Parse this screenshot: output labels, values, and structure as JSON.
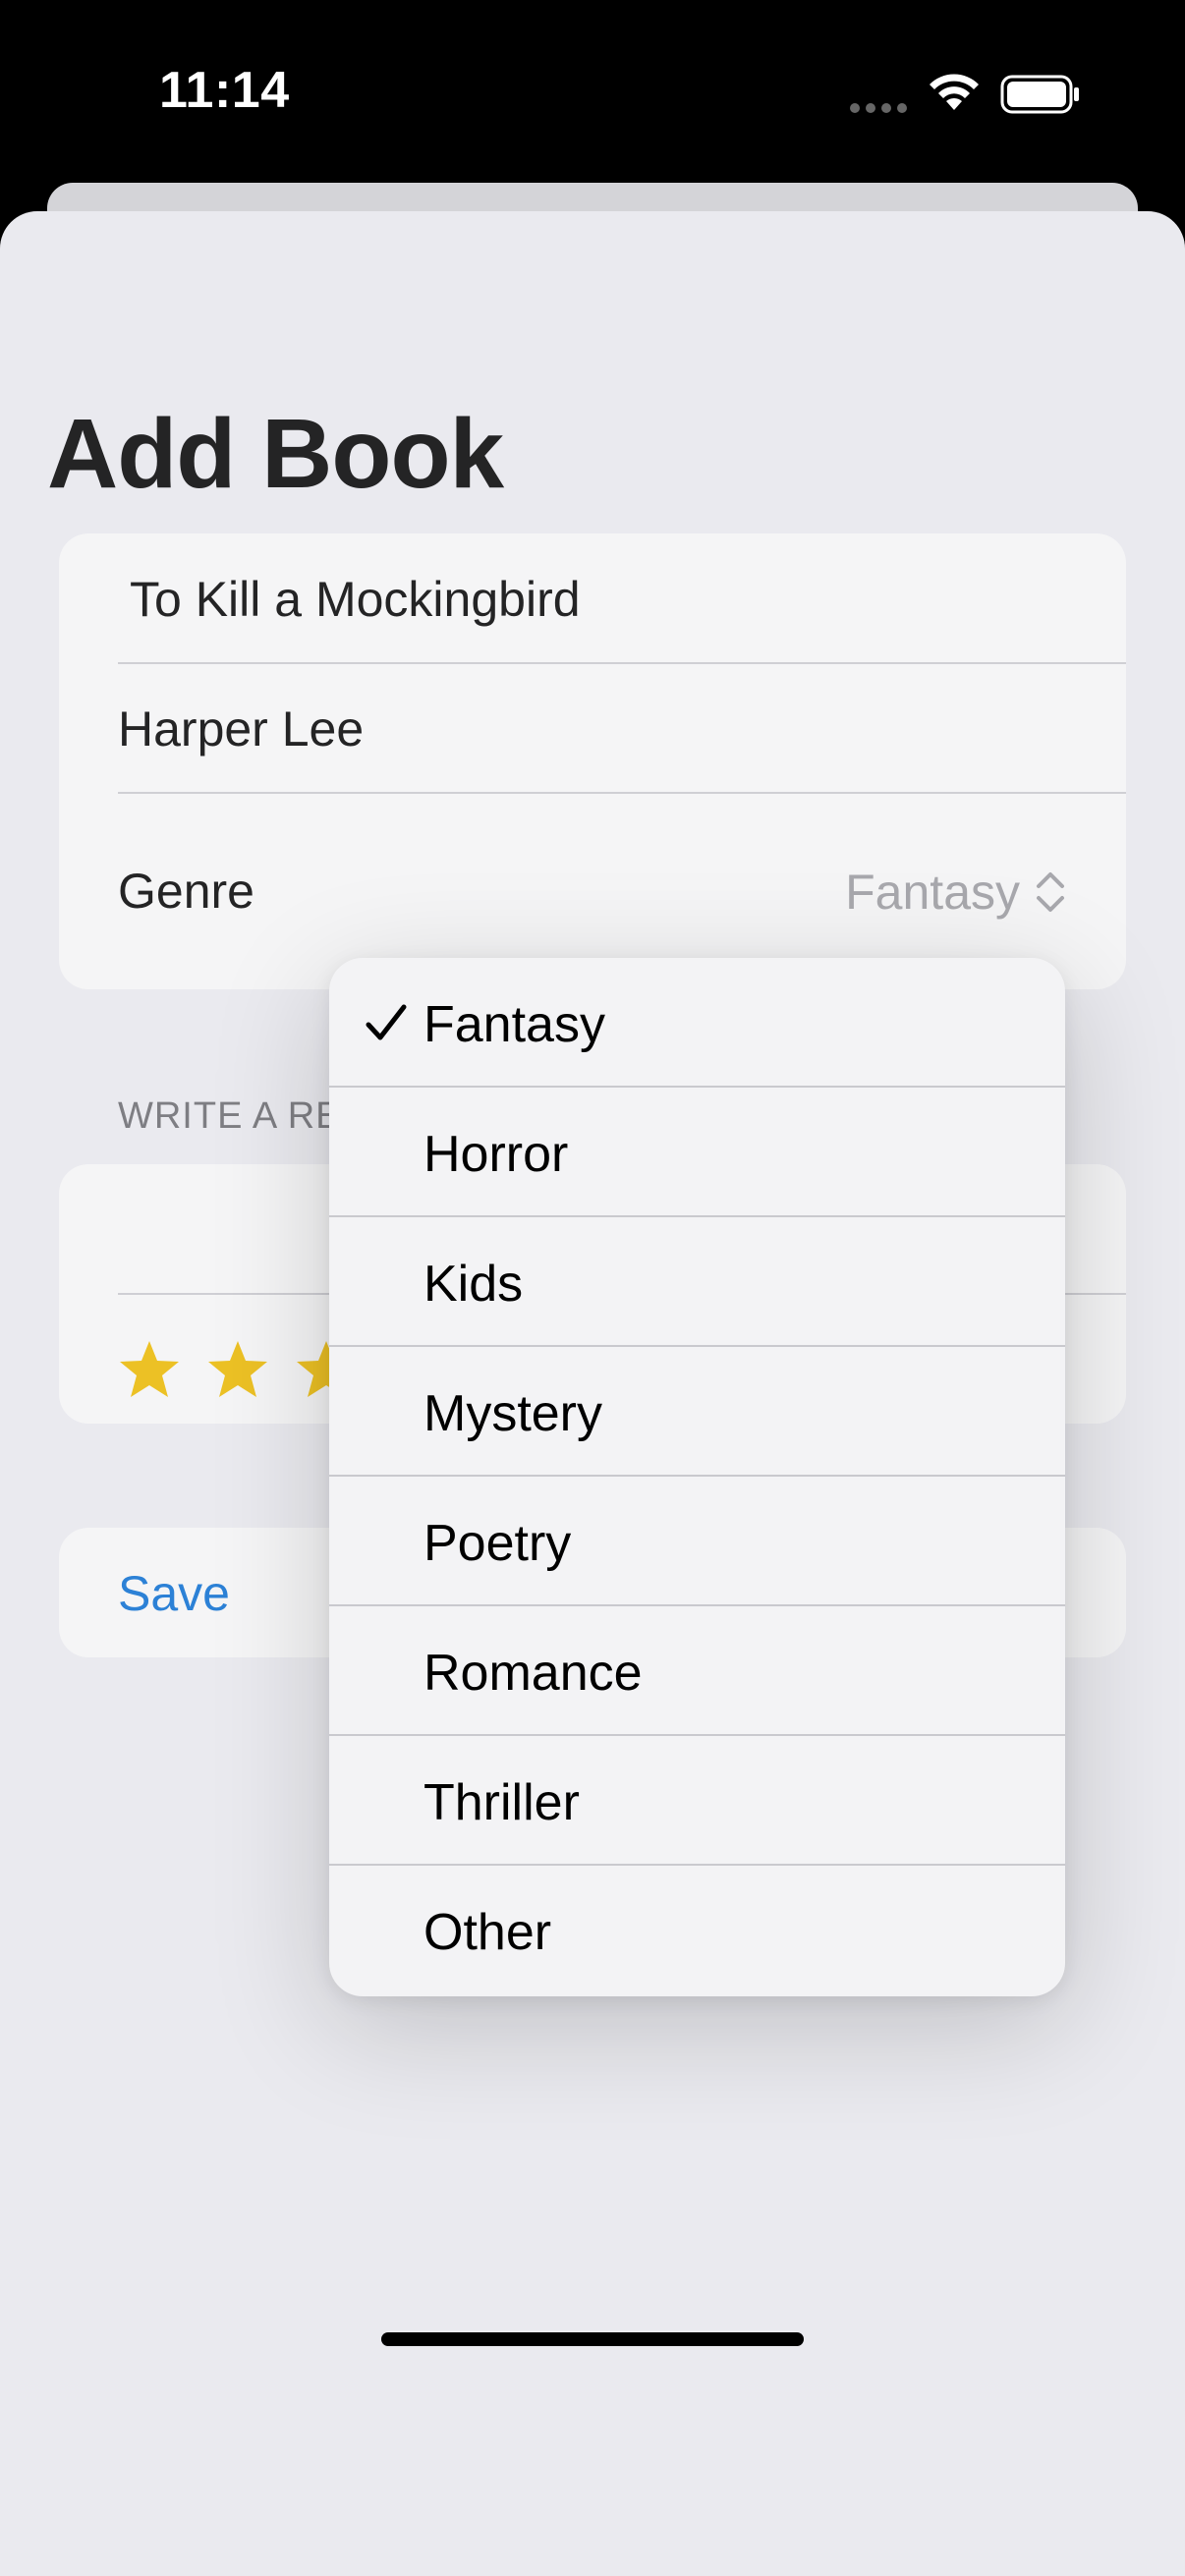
{
  "status_bar": {
    "time": "11:14"
  },
  "sheet": {
    "title": "Add Book",
    "fields": {
      "title_value": "To Kill a Mockingbird",
      "author_value": "Harper Lee",
      "genre_label": "Genre",
      "genre_value": "Fantasy"
    },
    "review_section": {
      "header": "WRITE A RE",
      "rating_stars_visible": 3,
      "star_color": "#f5c000"
    },
    "save_label": "Save",
    "accent_color": "#0a72d8"
  },
  "genre_menu": {
    "selected": "Fantasy",
    "options": [
      {
        "label": "Fantasy",
        "checked": true
      },
      {
        "label": "Horror",
        "checked": false
      },
      {
        "label": "Kids",
        "checked": false
      },
      {
        "label": "Mystery",
        "checked": false
      },
      {
        "label": "Poetry",
        "checked": false
      },
      {
        "label": "Romance",
        "checked": false
      },
      {
        "label": "Thriller",
        "checked": false
      },
      {
        "label": "Other",
        "checked": false
      }
    ]
  }
}
